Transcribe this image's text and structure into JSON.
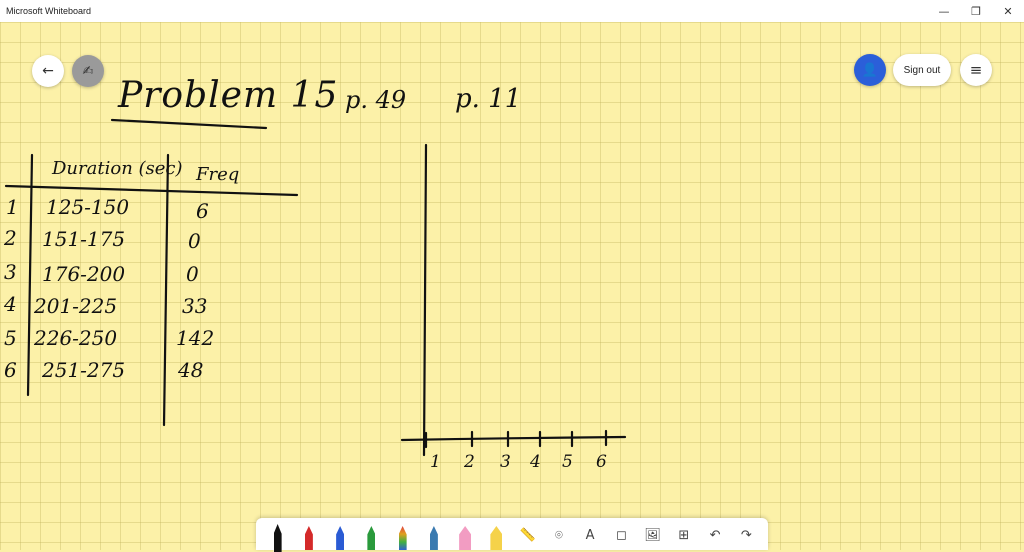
{
  "window": {
    "title": "Microsoft Whiteboard",
    "controls": {
      "minimize": "—",
      "restore": "❐",
      "close": "✕"
    }
  },
  "top_left": {
    "back_icon": "←",
    "ink_icon": "✍"
  },
  "top_right": {
    "share_icon": "👤",
    "sign_out_label": "Sign out",
    "menu_icon": "≡"
  },
  "ink": {
    "title": "Problem 15",
    "page_ref_1": "p. 49",
    "page_ref_2": "p. 11",
    "table": {
      "headers": [
        "Duration (sec)",
        "Freq"
      ],
      "rows": [
        {
          "index": "1",
          "duration": "125-150",
          "freq": "6"
        },
        {
          "index": "2",
          "duration": "151-175",
          "freq": "0"
        },
        {
          "index": "3",
          "duration": "176-200",
          "freq": "0"
        },
        {
          "index": "4",
          "duration": "201-225",
          "freq": "33"
        },
        {
          "index": "5",
          "duration": "226-250",
          "freq": "142"
        },
        {
          "index": "6",
          "duration": "251-275",
          "freq": "48"
        }
      ]
    },
    "axis_ticks": [
      "1",
      "2",
      "3",
      "4",
      "5",
      "6"
    ]
  },
  "toolbar": {
    "pens": [
      {
        "name": "black",
        "color": "#111111"
      },
      {
        "name": "red",
        "color": "#d42a2a"
      },
      {
        "name": "blue",
        "color": "#2a5bd4"
      },
      {
        "name": "green",
        "color": "#2a9a3c"
      },
      {
        "name": "rainbow",
        "color": "#e08a1e"
      },
      {
        "name": "galaxy",
        "color": "#3a7ab0"
      }
    ],
    "highlighters": [
      {
        "name": "pink",
        "color": "#f29cc2"
      },
      {
        "name": "yellow",
        "color": "#f5d24a"
      }
    ],
    "tools": {
      "ruler_icon": "📏",
      "lasso_icon": "⌾",
      "text_icon": "A",
      "note_icon": "◻",
      "image_icon": "🖼",
      "add_icon": "⊞",
      "undo_icon": "↶",
      "redo_icon": "↷"
    }
  }
}
